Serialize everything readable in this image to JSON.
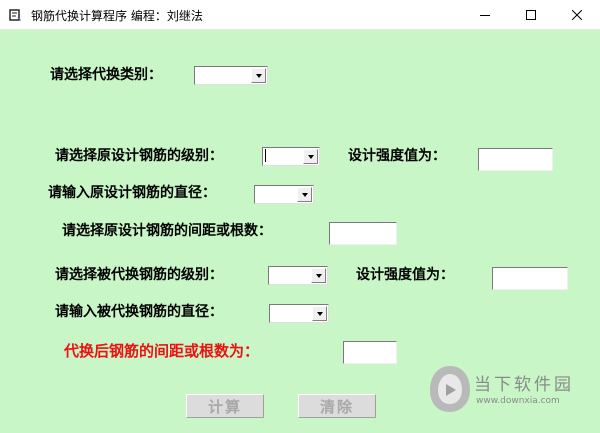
{
  "window": {
    "title": "钢筋代换计算程序 编程：刘继法",
    "minimize_icon": "minimize-icon",
    "maximize_icon": "maximize-icon",
    "close_icon": "close-icon"
  },
  "form": {
    "type_label": "请选择代换类别：",
    "type_value": "",
    "orig_grade_label": "请选择原设计钢筋的级别：",
    "orig_grade_value": "",
    "orig_strength_label": "设计强度值为：",
    "orig_strength_value": "",
    "orig_diameter_label": "请输入原设计钢筋的直径：",
    "orig_diameter_value": "",
    "orig_spacing_label": "请选择原设计钢筋的间距或根数：",
    "orig_spacing_value": "",
    "new_grade_label": "请选择被代换钢筋的级别：",
    "new_grade_value": "",
    "new_strength_label": "设计强度值为：",
    "new_strength_value": "",
    "new_diameter_label": "请输入被代换钢筋的直径：",
    "new_diameter_value": "",
    "result_label": "代换后钢筋的间距或根数为：",
    "result_value": ""
  },
  "buttons": {
    "calculate_label": "计算",
    "clear_label": "清除"
  },
  "watermark": {
    "text_cn": "当下软件园",
    "text_en": "www.downxia.com"
  },
  "colors": {
    "client_bg": "#c8f6c6",
    "result_label": "#ee1111",
    "disabled_text": "#a8a8a8"
  }
}
